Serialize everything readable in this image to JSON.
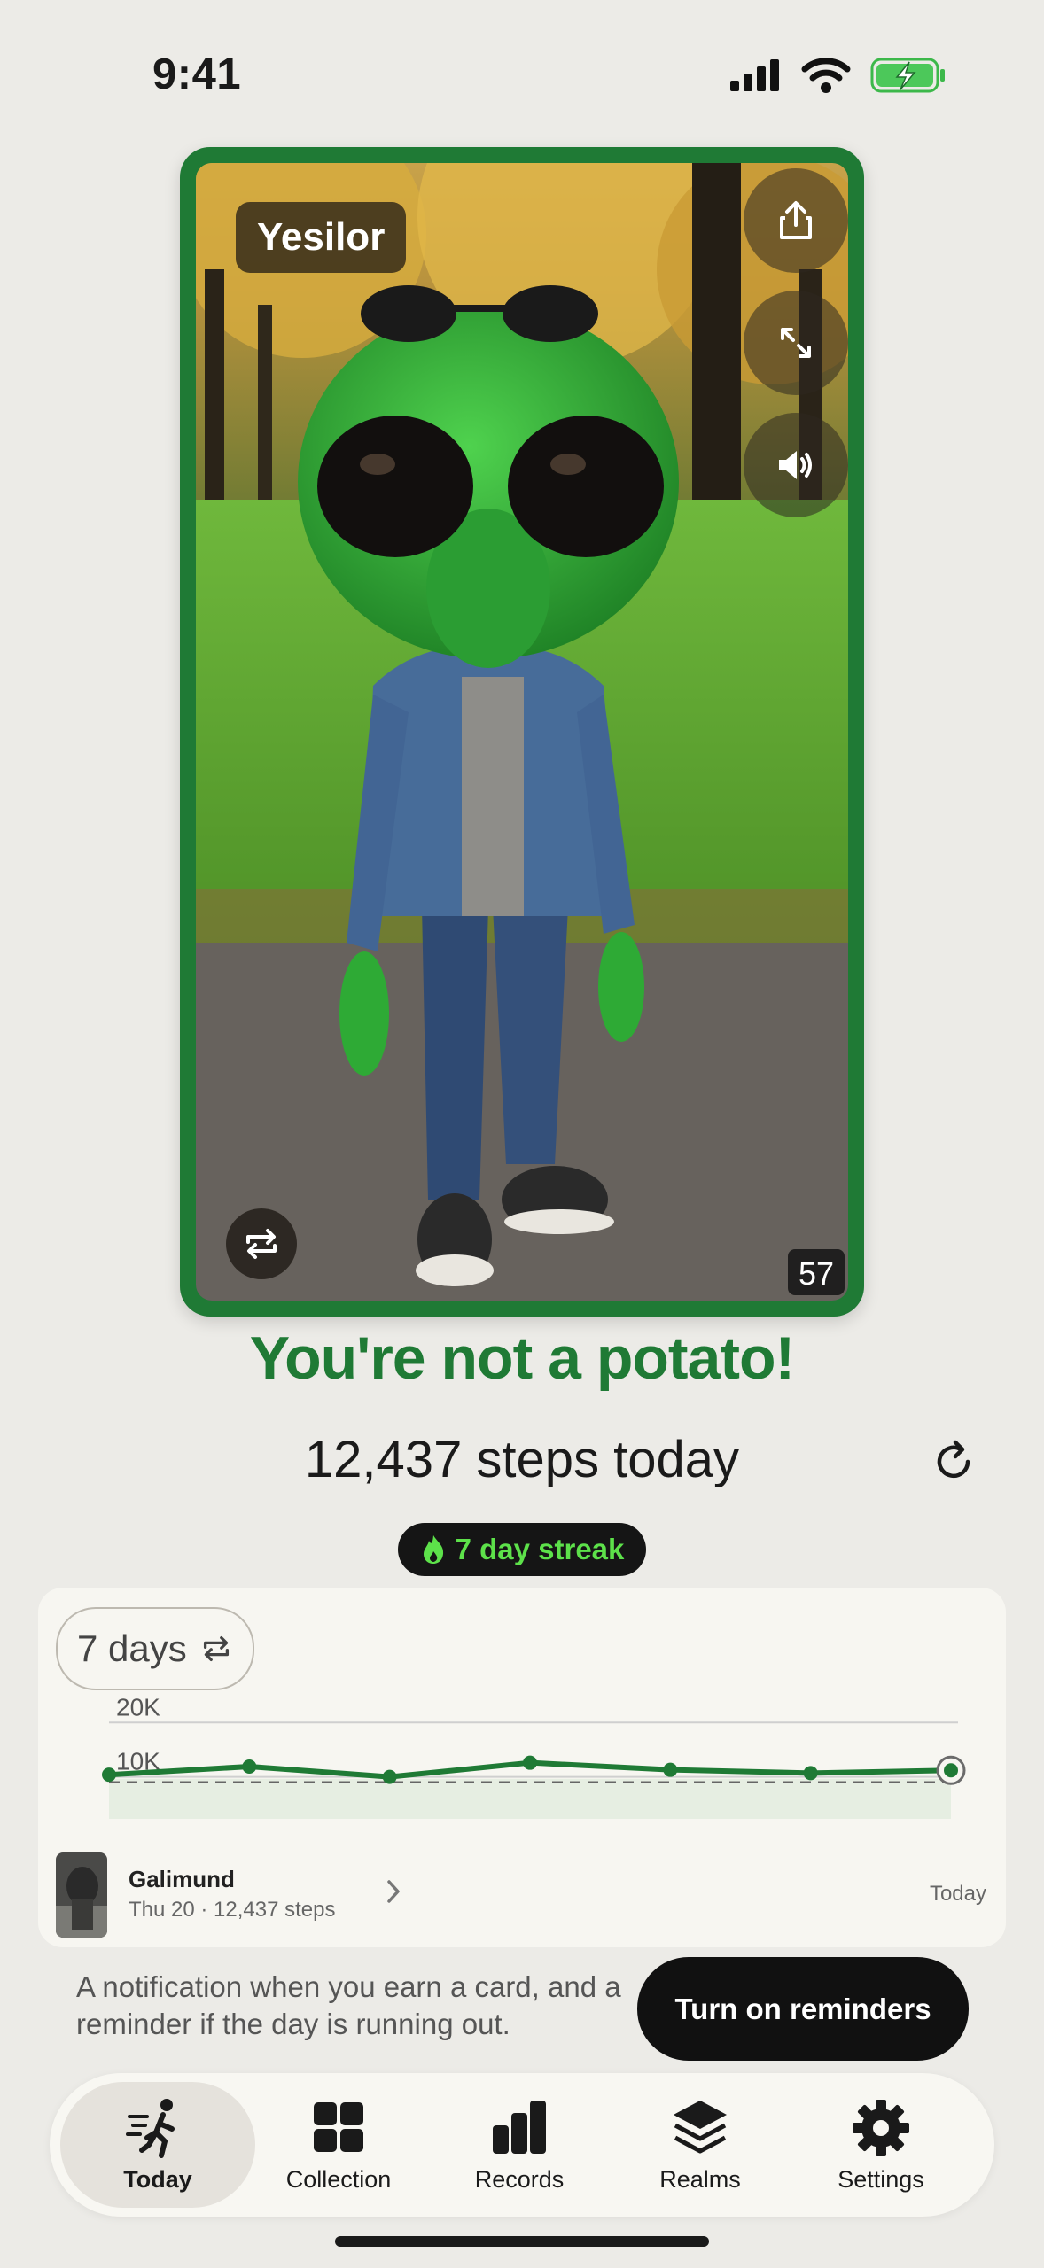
{
  "status_bar": {
    "time": "9:41"
  },
  "card": {
    "creature_name": "Yesilor",
    "count": "57",
    "image_desc": "green alien with sunglasses, denim jacket, jeans and sneakers in an autumn park"
  },
  "headline": "You're not a potato!",
  "steps_text": "12,437 steps today",
  "streak_label": "7 day streak",
  "summary": {
    "range_label": "7 days",
    "y_ticks": [
      "20K",
      "10K"
    ],
    "entry": {
      "name": "Galimund",
      "subtitle": "Thu 20 · 12,437 steps",
      "date": "Today"
    }
  },
  "chart_data": {
    "type": "line",
    "x": [
      1,
      2,
      3,
      4,
      5,
      6,
      7
    ],
    "series": [
      {
        "values": [
          10400,
          11900,
          10000,
          12600,
          11300,
          10700,
          11200
        ]
      }
    ],
    "goal": 9000,
    "ylim": [
      0,
      22000
    ],
    "y_ticks": [
      "20K",
      "10K"
    ],
    "grid": true
  },
  "notification_text": "A notification when you earn a card, and a reminder if the day is running out.",
  "reminder_button": "Turn on reminders",
  "tabs": [
    {
      "label": "Today",
      "icon": "walking-person-icon",
      "active": true
    },
    {
      "label": "Collection",
      "icon": "grid-icon",
      "active": false
    },
    {
      "label": "Records",
      "icon": "bar-chart-icon",
      "active": false
    },
    {
      "label": "Realms",
      "icon": "layers-icon",
      "active": false
    },
    {
      "label": "Settings",
      "icon": "gear-icon",
      "active": false
    }
  ],
  "colors": {
    "accent": "#1f7a35",
    "streak": "#5de14a",
    "background": "#ecebe7"
  }
}
